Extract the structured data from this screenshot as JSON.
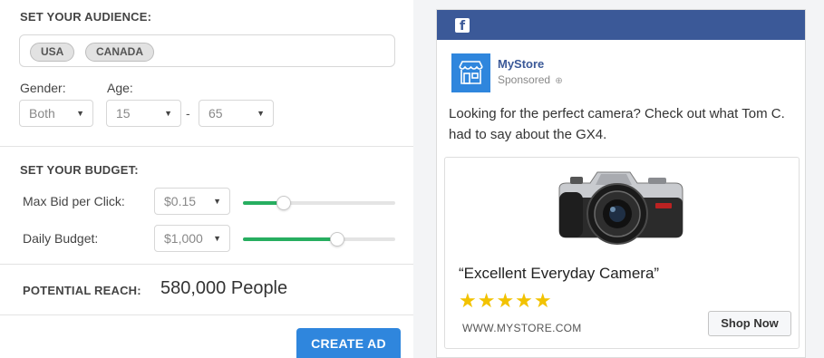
{
  "audience": {
    "title": "SET YOUR AUDIENCE:",
    "countries": [
      "USA",
      "CANADA"
    ],
    "gender_label": "Gender:",
    "gender_value": "Both",
    "age_label": "Age:",
    "age_min": "15",
    "age_max": "65",
    "age_separator": "-"
  },
  "budget": {
    "title": "SET YOUR BUDGET:",
    "max_bid_label": "Max Bid per Click:",
    "max_bid_value": "$0.15",
    "max_bid_slider_fraction": 0.27,
    "daily_label": "Daily Budget:",
    "daily_value": "$1,000",
    "daily_slider_fraction": 0.62
  },
  "reach": {
    "label": "POTENTIAL REACH:",
    "value": "580,000 People"
  },
  "actions": {
    "create_label": "CREATE AD"
  },
  "ad_preview": {
    "platform_logo": "f",
    "store_name": "MyStore",
    "sponsored_label": "Sponsored",
    "copy": "Looking for the perfect camera? Check out what Tom C. had to say about the GX4.",
    "headline": "“Excellent Everyday Camera”",
    "stars": "★★★★★",
    "rating": 5,
    "url": "WWW.MYSTORE.COM",
    "cta_label": "Shop Now"
  },
  "colors": {
    "accent_blue": "#2f86dd",
    "facebook_blue": "#3b5998",
    "slider_green": "#27ae60",
    "star_yellow": "#f2c200"
  },
  "icons": {
    "facebook": "facebook-logo-icon",
    "store": "storefront-icon",
    "globe": "globe-icon",
    "caret": "caret-down-icon",
    "product": "camera-image"
  }
}
